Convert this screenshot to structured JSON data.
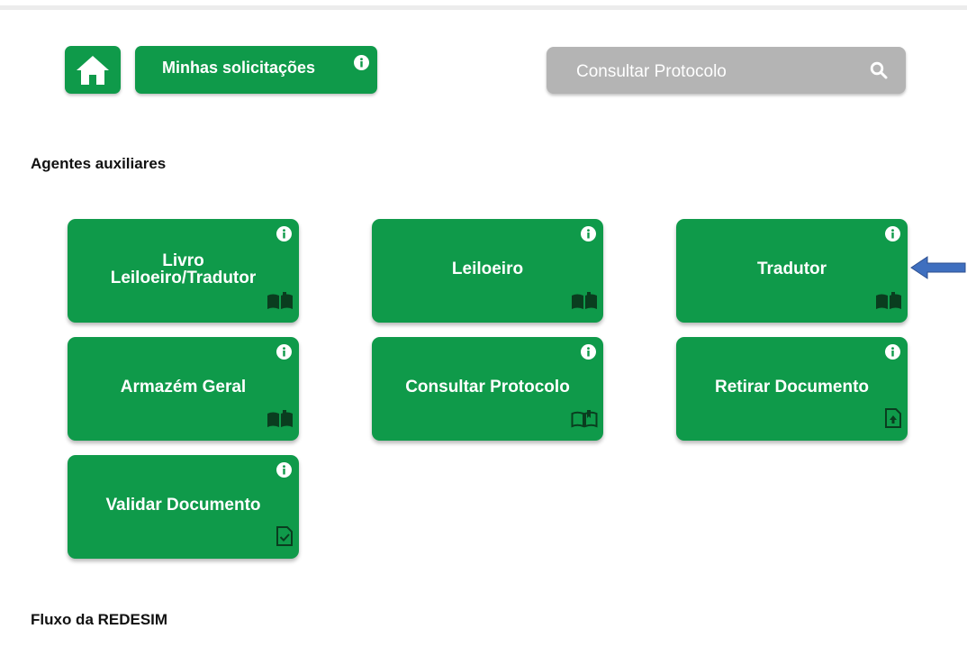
{
  "header": {
    "home_icon": "home-icon",
    "my_requests_label": "Minhas solicitações",
    "info_icon": "info-icon",
    "search_placeholder": "Consultar Protocolo",
    "search_icon": "search-icon"
  },
  "sections": {
    "agents_title": "Agentes auxiliares",
    "redesim_title": "Fluxo da REDESIM"
  },
  "cards": [
    {
      "title": "Livro\nLeiloeiro/Tradutor",
      "corner_icon": "book-icon"
    },
    {
      "title": "Leiloeiro",
      "corner_icon": "book-icon"
    },
    {
      "title": "Tradutor",
      "corner_icon": "book-icon"
    },
    {
      "title": "Armazém Geral",
      "corner_icon": "book-icon"
    },
    {
      "title": "Consultar Protocolo",
      "corner_icon": "book-outline-icon"
    },
    {
      "title": "Retirar Documento",
      "corner_icon": "file-upload-icon"
    },
    {
      "title": "Validar Documento",
      "corner_icon": "file-check-icon"
    }
  ],
  "colors": {
    "brand_green": "#0f9a4a",
    "search_bg": "#b4b4b4",
    "arrow_blue": "#3f6fbf"
  },
  "annotation": {
    "arrow_icon": "left-arrow-icon"
  }
}
